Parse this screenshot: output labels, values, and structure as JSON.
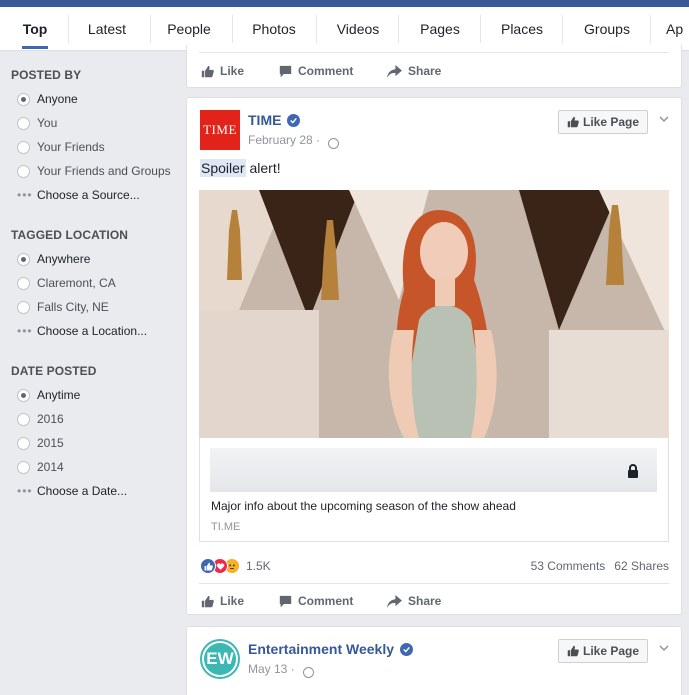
{
  "tabs": [
    {
      "label": "Top",
      "active": true
    },
    {
      "label": "Latest"
    },
    {
      "label": "People"
    },
    {
      "label": "Photos"
    },
    {
      "label": "Videos"
    },
    {
      "label": "Pages"
    },
    {
      "label": "Places"
    },
    {
      "label": "Groups"
    },
    {
      "label": "Ap"
    }
  ],
  "sidebar": {
    "posted_by": {
      "title": "POSTED BY",
      "options": [
        "Anyone",
        "You",
        "Your Friends",
        "Your Friends and Groups"
      ],
      "selected": "Anyone",
      "choose": "Choose a Source..."
    },
    "tagged_location": {
      "title": "TAGGED LOCATION",
      "options": [
        "Anywhere",
        "Claremont, CA",
        "Falls City, NE"
      ],
      "selected": "Anywhere",
      "choose": "Choose a Location..."
    },
    "date_posted": {
      "title": "DATE POSTED",
      "options": [
        "Anytime",
        "2016",
        "2015",
        "2014"
      ],
      "selected": "Anytime",
      "choose": "Choose a Date..."
    }
  },
  "actions": {
    "like": "Like",
    "comment": "Comment",
    "share": "Share"
  },
  "post1": {
    "avatar_text": "TIME",
    "page_name": "TIME",
    "date": "February 28 ·",
    "like_page": "Like Page",
    "text_highlight": "Spoiler",
    "text_rest": " alert!",
    "link_title": "Major info about the upcoming season of the show ahead",
    "link_domain": "TI.ME",
    "reaction_count": "1.5K",
    "comments": "53 Comments",
    "shares": "62 Shares"
  },
  "post2": {
    "avatar_text": "EW",
    "page_name": "Entertainment Weekly",
    "date": "May 13 ·",
    "like_page": "Like Page"
  },
  "colors": {
    "brand": "#3b5998",
    "link": "#365899",
    "accent": "#4267b2",
    "time_red": "#e2231a",
    "ew_teal": "#3bb8b3"
  },
  "icons": [
    "thumbs-up-icon",
    "comment-icon",
    "share-icon",
    "verified-icon",
    "globe-icon",
    "lock-icon",
    "chevron-down-icon",
    "like-reaction-icon",
    "love-reaction-icon",
    "angry-reaction-icon"
  ]
}
